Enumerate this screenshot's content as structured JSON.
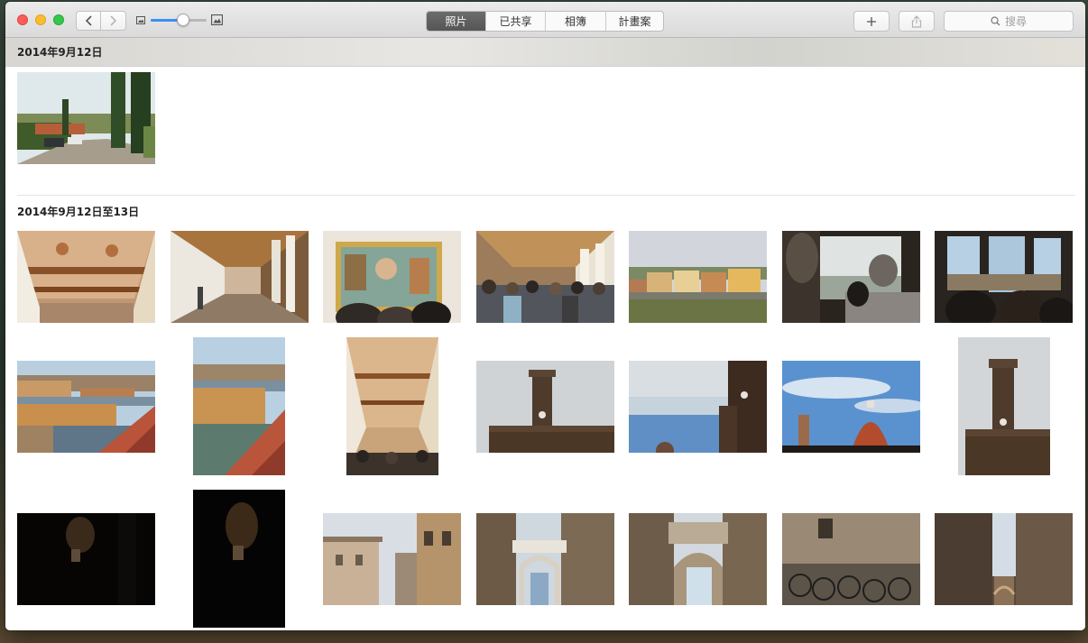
{
  "app": {
    "name": "Photos"
  },
  "toolbar": {
    "tabs": [
      {
        "label": "照片",
        "active": true
      },
      {
        "label": "已共享",
        "active": false
      },
      {
        "label": "相簿",
        "active": false
      },
      {
        "label": "計畫案",
        "active": false
      }
    ],
    "zoom_level": 0.58,
    "add_icon": "plus-icon",
    "share_icon": "share-icon",
    "search_placeholder": "搜尋"
  },
  "moments": [
    {
      "title": "2014年9月12日",
      "photos": [
        "tuscan-road-cypress"
      ]
    },
    {
      "title": "2014年9月12日至13日",
      "photos": [
        "uffizi-ceiling",
        "uffizi-corridor",
        "birth-of-venus-crowd",
        "gallery-crowd",
        "arno-riverbank",
        "statue-window-visitor",
        "window-visitors",
        "ponte-vecchio",
        "ponte-vecchio-vertical",
        "ceiling-vertical",
        "palazzo-vecchio-tower",
        "tower-cloudy-sky",
        "duomo-skyline",
        "palazzo-vecchio-vertical",
        "dark-corridor",
        "dark-corridor-vertical",
        "florence-buildings",
        "narrow-street-arch",
        "vasari-arch",
        "bicycles-wall",
        "stone-street"
      ]
    }
  ],
  "colors": {
    "accent": "#3b8ef5",
    "active_tab": "#5e5e5e"
  }
}
